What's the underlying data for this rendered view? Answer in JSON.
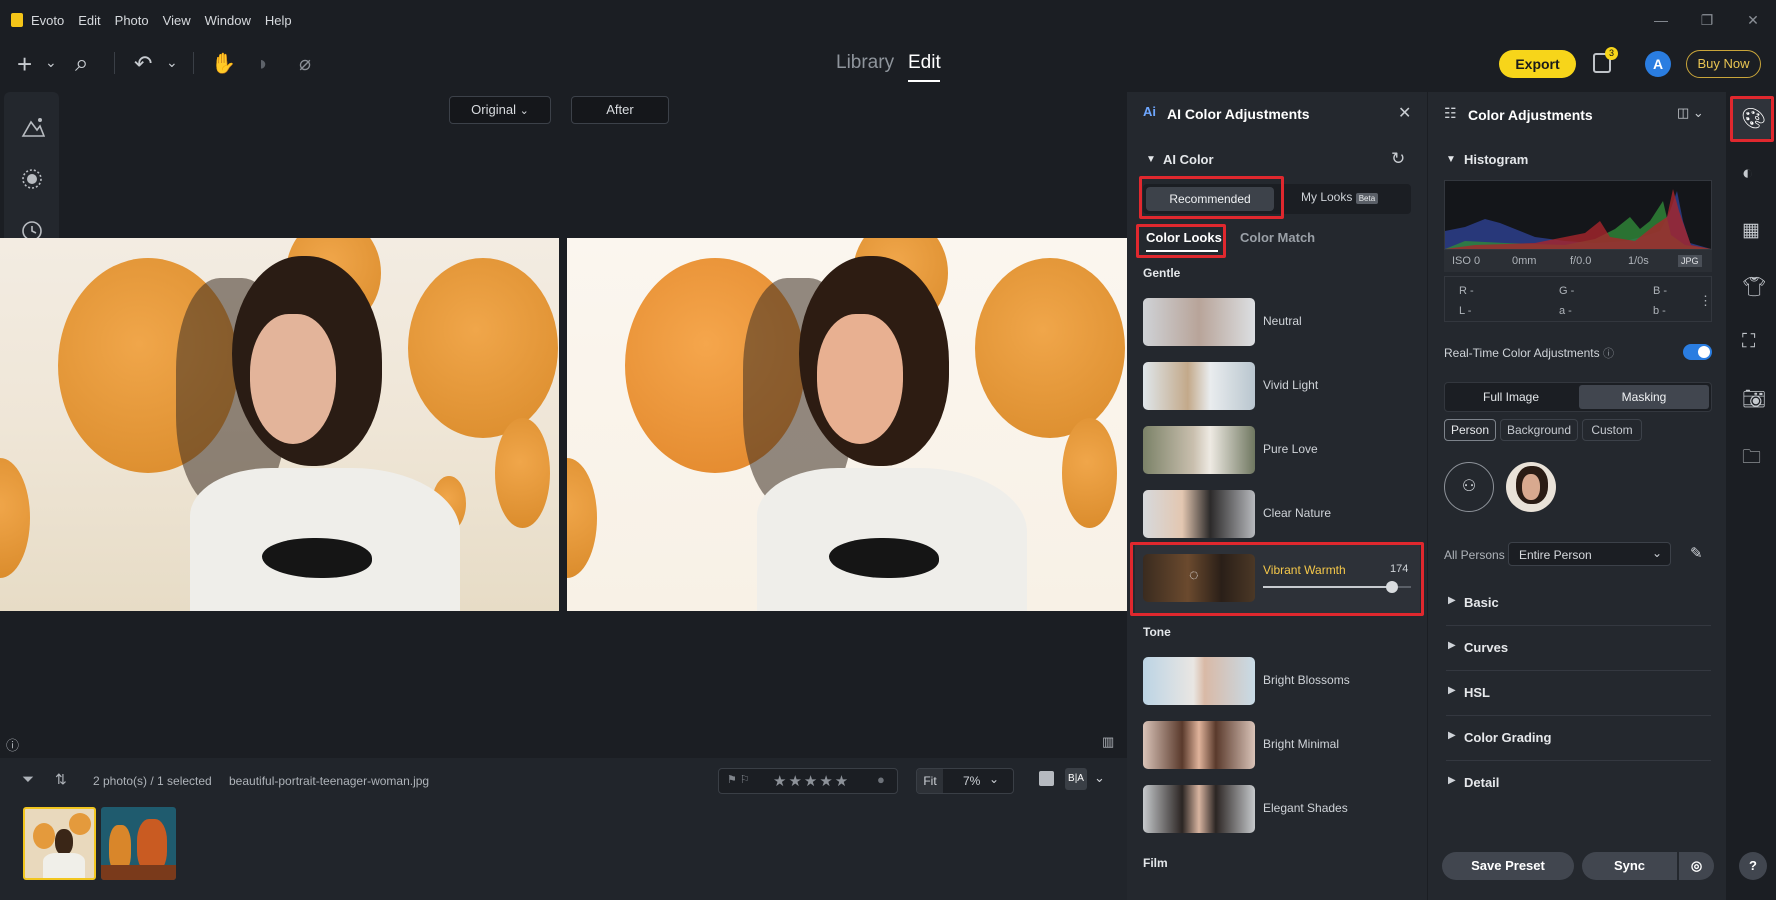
{
  "app": {
    "name": "Evoto"
  },
  "menu": [
    "Edit",
    "Photo",
    "View",
    "Window",
    "Help"
  ],
  "window_controls": {
    "minimize": "—",
    "restore": "❐",
    "close": "✕"
  },
  "toolbar": {
    "add": "+",
    "add_chevron": "⌄",
    "search": "⌕",
    "undo": "↶",
    "undo_chevron": "⌄",
    "hand": "✋",
    "heal": "◗",
    "patch": "⌀"
  },
  "tabs": {
    "library": "Library",
    "edit": "Edit"
  },
  "header": {
    "export": "Export",
    "notifications": "3",
    "avatar": "A",
    "buy_now": "Buy Now"
  },
  "left_tools": [
    "adjust-icon",
    "mask-icon",
    "history-icon"
  ],
  "compare": {
    "original": "Original",
    "after": "After"
  },
  "filmstrip": {
    "count_text": "2 photo(s) / 1 selected",
    "filename": "beautiful-portrait-teenager-woman.jpg",
    "fit": "Fit",
    "zoom": "7%"
  },
  "ai_panel": {
    "title": "AI Color Adjustments",
    "ai_color_label": "AI Color",
    "tabs": {
      "recommended": "Recommended",
      "my_looks": "My Looks",
      "beta": "Beta"
    },
    "subtabs": {
      "color_looks": "Color Looks",
      "color_match": "Color Match"
    },
    "groups": {
      "gentle": "Gentle",
      "tone": "Tone",
      "film": "Film"
    },
    "gentle_looks": [
      {
        "name": "Neutral"
      },
      {
        "name": "Vivid Light"
      },
      {
        "name": "Pure Love"
      },
      {
        "name": "Clear Nature"
      }
    ],
    "selected_look": {
      "name": "Vibrant Warmth",
      "value": "174",
      "fraction": 0.87
    },
    "tone_looks": [
      {
        "name": "Bright Blossoms"
      },
      {
        "name": "Bright Minimal"
      },
      {
        "name": "Elegant Shades"
      }
    ]
  },
  "right_panel": {
    "title": "Color Adjustments",
    "histogram": {
      "title": "Histogram",
      "iso": "ISO 0",
      "mm": "0mm",
      "fstop": "f/0.0",
      "shutter": "1/0s",
      "format": "JPG",
      "r": "R -",
      "g": "G -",
      "b": "B -",
      "l": "L -",
      "a": "a -",
      "b2": "b -"
    },
    "realtime_label": "Real-Time Color Adjustments",
    "realtime_on": true,
    "scope": {
      "full_image": "Full Image",
      "masking": "Masking"
    },
    "mask_targets": {
      "person": "Person",
      "background": "Background",
      "custom": "Custom"
    },
    "persons": {
      "label": "All Persons",
      "selection": "Entire Person"
    },
    "sections": [
      "Basic",
      "Curves",
      "HSL",
      "Color Grading",
      "Detail"
    ],
    "buttons": {
      "save_preset": "Save Preset",
      "sync": "Sync"
    }
  },
  "colors": {
    "accent_yellow": "#F7D51A",
    "highlight_red": "#E0282E",
    "toggle_blue": "#2A7DE1",
    "selected_look_text": "#F5C84A"
  }
}
